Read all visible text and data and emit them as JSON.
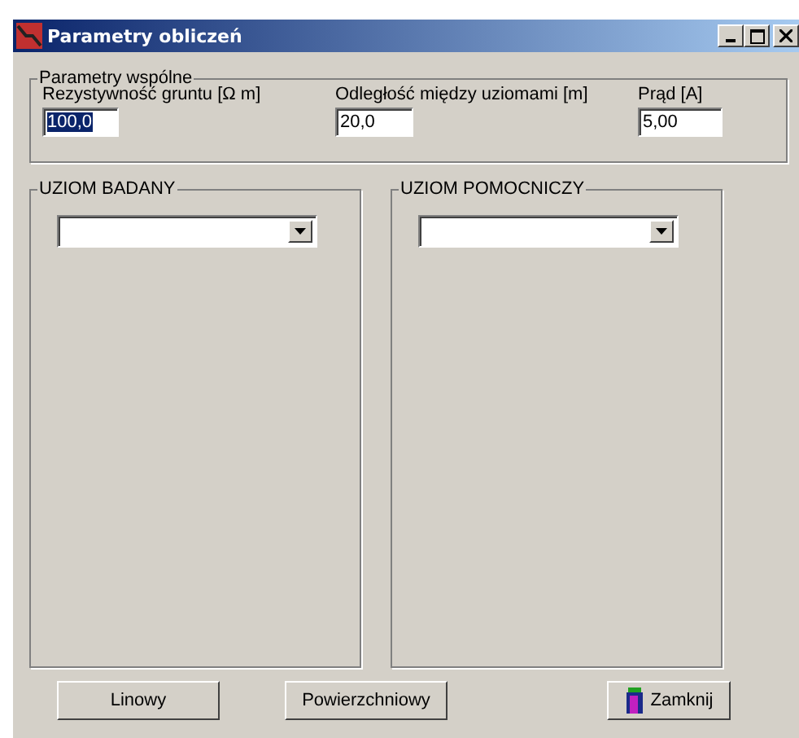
{
  "window": {
    "title": "Parametry obliczeń"
  },
  "common": {
    "title": "Parametry wspólne",
    "fields": [
      {
        "label": "Rezystywność gruntu [Ω m]",
        "value": "100,0",
        "selected": true
      },
      {
        "label": "Odległość między uziomami  [m]",
        "value": "20,0",
        "selected": false
      },
      {
        "label": "Prąd  [A]",
        "value": "5,00",
        "selected": false
      }
    ]
  },
  "groups": [
    {
      "title": "UZIOM BADANY"
    },
    {
      "title": "UZIOM POMOCNICZY"
    }
  ],
  "buttons": [
    {
      "label": "Linowy",
      "kind": "plain"
    },
    {
      "label": "Powierzchniowy",
      "kind": "plain"
    },
    {
      "label": "Zamknij",
      "kind": "icon"
    }
  ]
}
